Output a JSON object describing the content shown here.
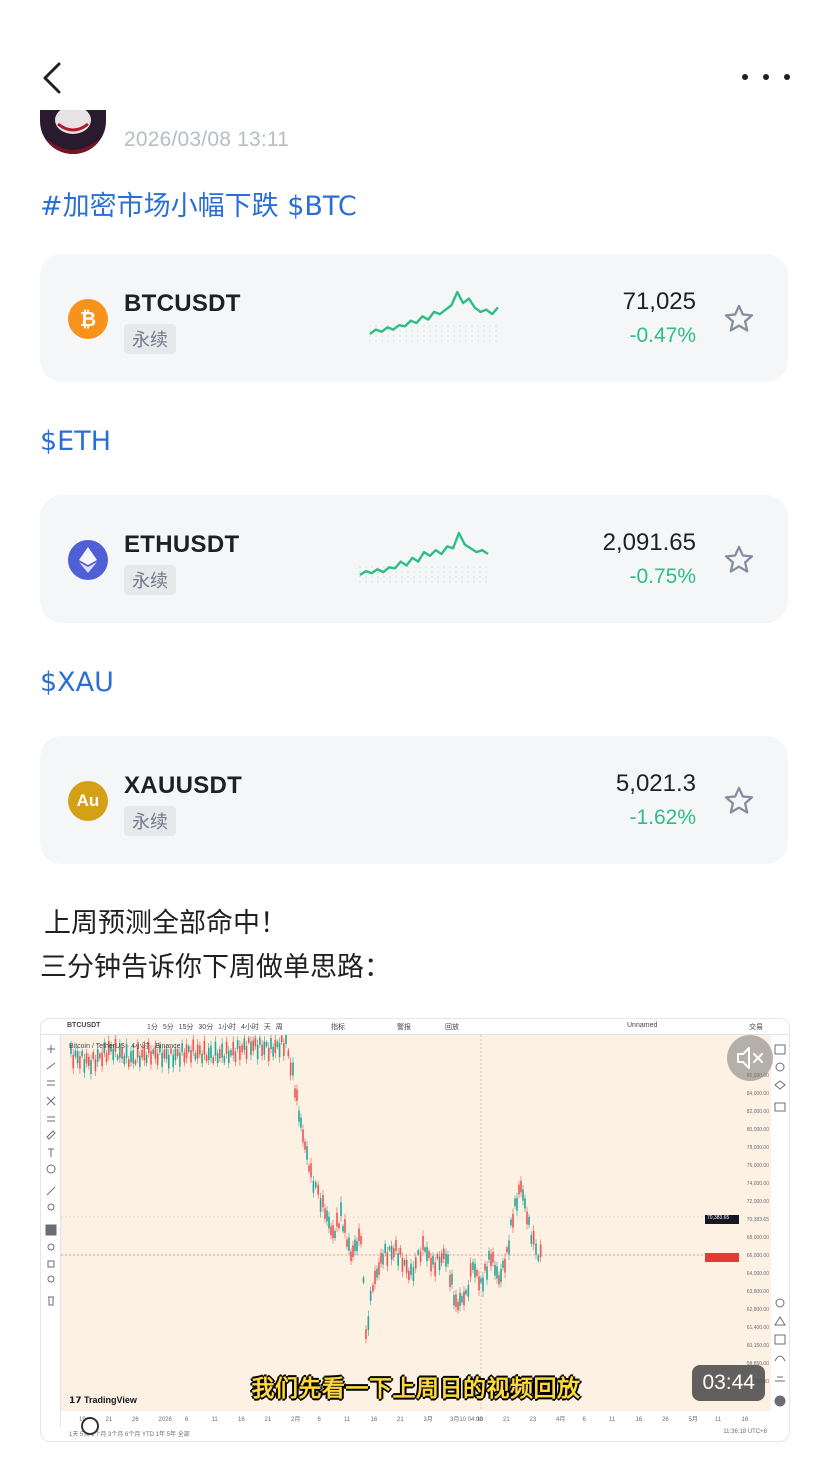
{
  "header": {
    "back_icon": "chevron-left-icon",
    "more_icon": "more-horizontal-icon"
  },
  "post": {
    "timestamp": "2026/03/08 13:11",
    "hashtag_line": "#加密市场小幅下跌 $BTC",
    "eth_tag": "$ETH",
    "xau_tag": "$XAU",
    "body_line1": "上周预测全部命中！",
    "body_line2": "三分钟告诉你下周做单思路："
  },
  "tickers": [
    {
      "pair": "BTCUSDT",
      "badge": "永续",
      "price": "71,025",
      "change": "-0.47%",
      "icon": "bitcoin-icon",
      "icon_color": "#f7931a",
      "sparkline": [
        2,
        6,
        4,
        8,
        6,
        10,
        9,
        14,
        12,
        18,
        15,
        22,
        20,
        24,
        28,
        40,
        30,
        34,
        26,
        22,
        24,
        20,
        26
      ]
    },
    {
      "pair": "ETHUSDT",
      "badge": "永续",
      "price": "2,091.65",
      "change": "-0.75%",
      "icon": "ethereum-icon",
      "icon_color": "#4f5fd6",
      "sparkline": [
        2,
        6,
        4,
        8,
        5,
        10,
        9,
        16,
        12,
        20,
        16,
        26,
        22,
        28,
        24,
        32,
        30,
        46,
        34,
        30,
        26,
        28,
        24
      ]
    },
    {
      "pair": "XAUUSDT",
      "badge": "永续",
      "price": "5,021.3",
      "change": "-1.62%",
      "icon": "gold-icon",
      "icon_color": "#d4a017",
      "icon_text": "Au"
    }
  ],
  "colors": {
    "link": "#2b6fd6",
    "positive_change": "#2ebd85",
    "card_bg": "#f5f6f7"
  },
  "video": {
    "subtitle": "我们先看一下上周日的视频回放",
    "duration": "03:44",
    "mute_icon": "volume-mute-icon",
    "tv_symbol": "BTCUSDT",
    "tv_timeframes": "1分 5分 15分 30分 1小时 4小时 天 周",
    "tv_indicators": "指标",
    "tv_alert": "警报",
    "tv_replay": "回放",
    "tv_layout": "Unnamed",
    "tv_trade": "交易",
    "tv_legend": "Bitcoin / TetherUS · 4小时 · Binance",
    "tv_logo": "TradingView",
    "tv_range": "1天 5天 1个月 3个月 6个月 YTD 1年 5年 全部",
    "tv_clock": "11:36:18 UTC+8",
    "tv_scale": [
      "86,000.00",
      "84,000.00",
      "82,000.00",
      "80,000.00",
      "78,000.00",
      "76,000.00",
      "74,000.00",
      "72,000.00",
      "70,383.65",
      "68,000.00",
      "66,000.00",
      "64,000.00",
      "63,800.00",
      "62,800.00",
      "61,400.00",
      "60,150.00",
      "58,850.00",
      "57,750.00"
    ],
    "tv_dates": [
      "19",
      "21",
      "26",
      "2026",
      "6",
      "11",
      "16",
      "21",
      "2月",
      "6",
      "11",
      "16",
      "21",
      "3月",
      "3月10 04:00",
      "18",
      "21",
      "23",
      "4月",
      "6",
      "11",
      "16",
      "26",
      "5月",
      "11",
      "16"
    ]
  }
}
